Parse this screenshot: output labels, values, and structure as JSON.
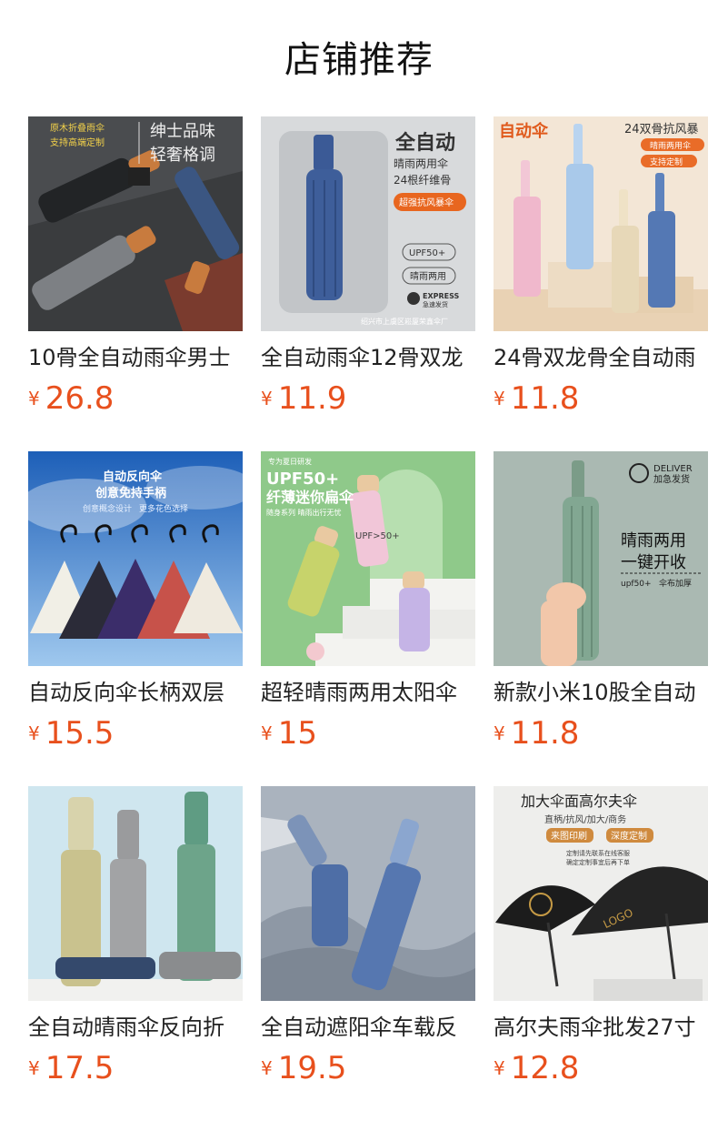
{
  "header": {
    "title": "店铺推荐"
  },
  "currency_symbol": "¥",
  "colors": {
    "price": "#e8501d"
  },
  "products": [
    {
      "name": "10骨全自动雨伞男士",
      "price": "26.8",
      "image_text": [
        "原木折叠雨伞",
        "支持高端定制",
        "绅士品味",
        "轻奢格调"
      ]
    },
    {
      "name": "全自动雨伞12骨双龙",
      "price": "11.9",
      "image_text": [
        "全自动",
        "晴雨两用伞",
        "24根纤维骨",
        "超强抗风暴伞",
        "UPF50+",
        "晴雨两用",
        "EXPRESS",
        "急速发货",
        "绍兴市上虞区崧厦荣鑫伞厂"
      ]
    },
    {
      "name": "24骨双龙骨全自动雨",
      "price": "11.8",
      "image_text": [
        "自动伞",
        "24双骨抗风暴",
        "晴雨两用伞",
        "支持定制"
      ]
    },
    {
      "name": "自动反向伞长柄双层",
      "price": "15.5",
      "image_text": [
        "自动反向伞",
        "创意免持手柄",
        "创意概念设计",
        "更多花色选择"
      ]
    },
    {
      "name": "超轻晴雨两用太阳伞",
      "price": "15",
      "image_text": [
        "专为夏日研发",
        "UPF50+",
        "纤薄迷你扁伞",
        "随身系列 晴雨出行无忧",
        "UPF>50+"
      ]
    },
    {
      "name": "新款小米10股全自动",
      "price": "11.8",
      "image_text": [
        "DELIVER",
        "加急发货",
        "晴雨两用",
        "一键开收",
        "upf50+",
        "伞布加厚"
      ]
    },
    {
      "name": "全自动晴雨伞反向折",
      "price": "17.5",
      "image_text": []
    },
    {
      "name": "全自动遮阳伞车载反",
      "price": "19.5",
      "image_text": []
    },
    {
      "name": "高尔夫雨伞批发27寸",
      "price": "12.8",
      "image_text": [
        "加大伞面高尔夫伞",
        "直柄/抗风/加大/商务",
        "来图印刷",
        "深度定制",
        "定制请先联系在线客服",
        "确定定制事宜后再下单",
        "LOGO"
      ]
    }
  ]
}
